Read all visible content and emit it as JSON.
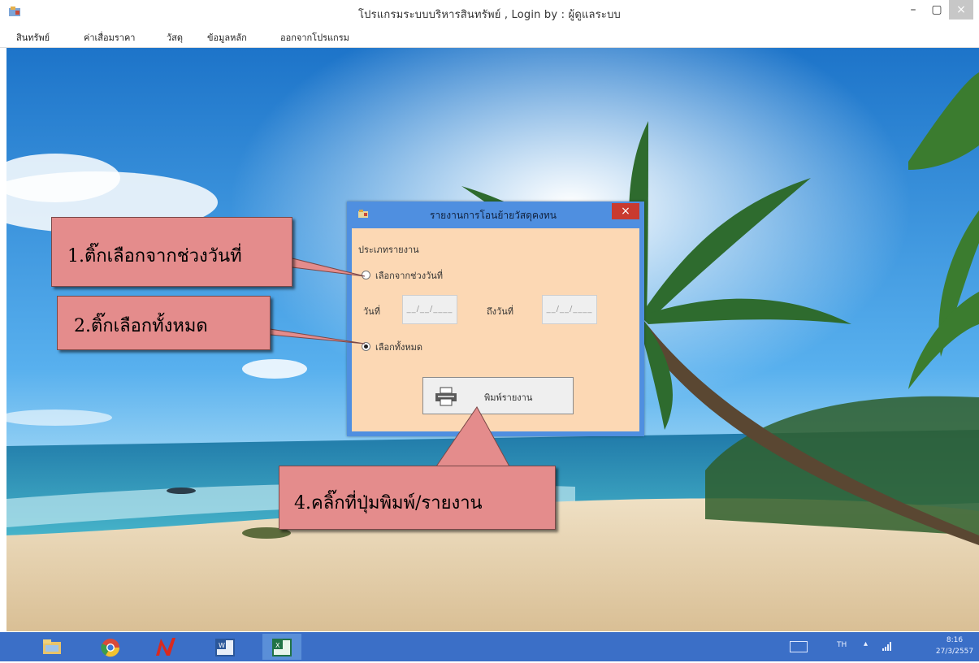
{
  "window": {
    "title": "โปรแกรมระบบบริหารสินทรัพย์ , Login by : ผู้ดูแลระบบ",
    "minimize": "–",
    "maximize": "▢",
    "close": "×"
  },
  "menu": {
    "items": [
      "สินทรัพย์",
      "ค่าเสื่อมราคา",
      "วัสดุ",
      "ข้อมูลหลัก",
      "ออกจากโปรแกรม"
    ]
  },
  "dialog": {
    "title": "รายงานการโอนย้ายวัสดุคงทน",
    "close": "×",
    "group_label": "ประเภทรายงาน",
    "radio_range": "เลือกจากช่วงวันที่",
    "from_label": "วันที่",
    "to_label": "ถึงวันที่",
    "date_placeholder": "__/__/____",
    "radio_all": "เลือกทั้งหมด",
    "selected": "all",
    "print_label": "พิมพ์รายงาน"
  },
  "callouts": {
    "c1": "1.ติ๊กเลือกจากช่วงวันที่",
    "c2": "2.ติ๊กเลือกทั้งหมด",
    "c4": "4.คลิ๊กที่ปุ่มพิมพ์/รายงาน"
  },
  "taskbar": {
    "apps": [
      "file-explorer-icon",
      "chrome-icon",
      "n-app-icon",
      "word-icon",
      "excel-icon"
    ],
    "lang": "TH",
    "time": "8:16",
    "date": "27/3/2557"
  },
  "colors": {
    "dialog_frame": "#4f8fe0",
    "dialog_body": "#fcd8b4",
    "callout_fill": "#e48c8c",
    "taskbar": "#3b6fc7",
    "close_red": "#c93a2f"
  }
}
